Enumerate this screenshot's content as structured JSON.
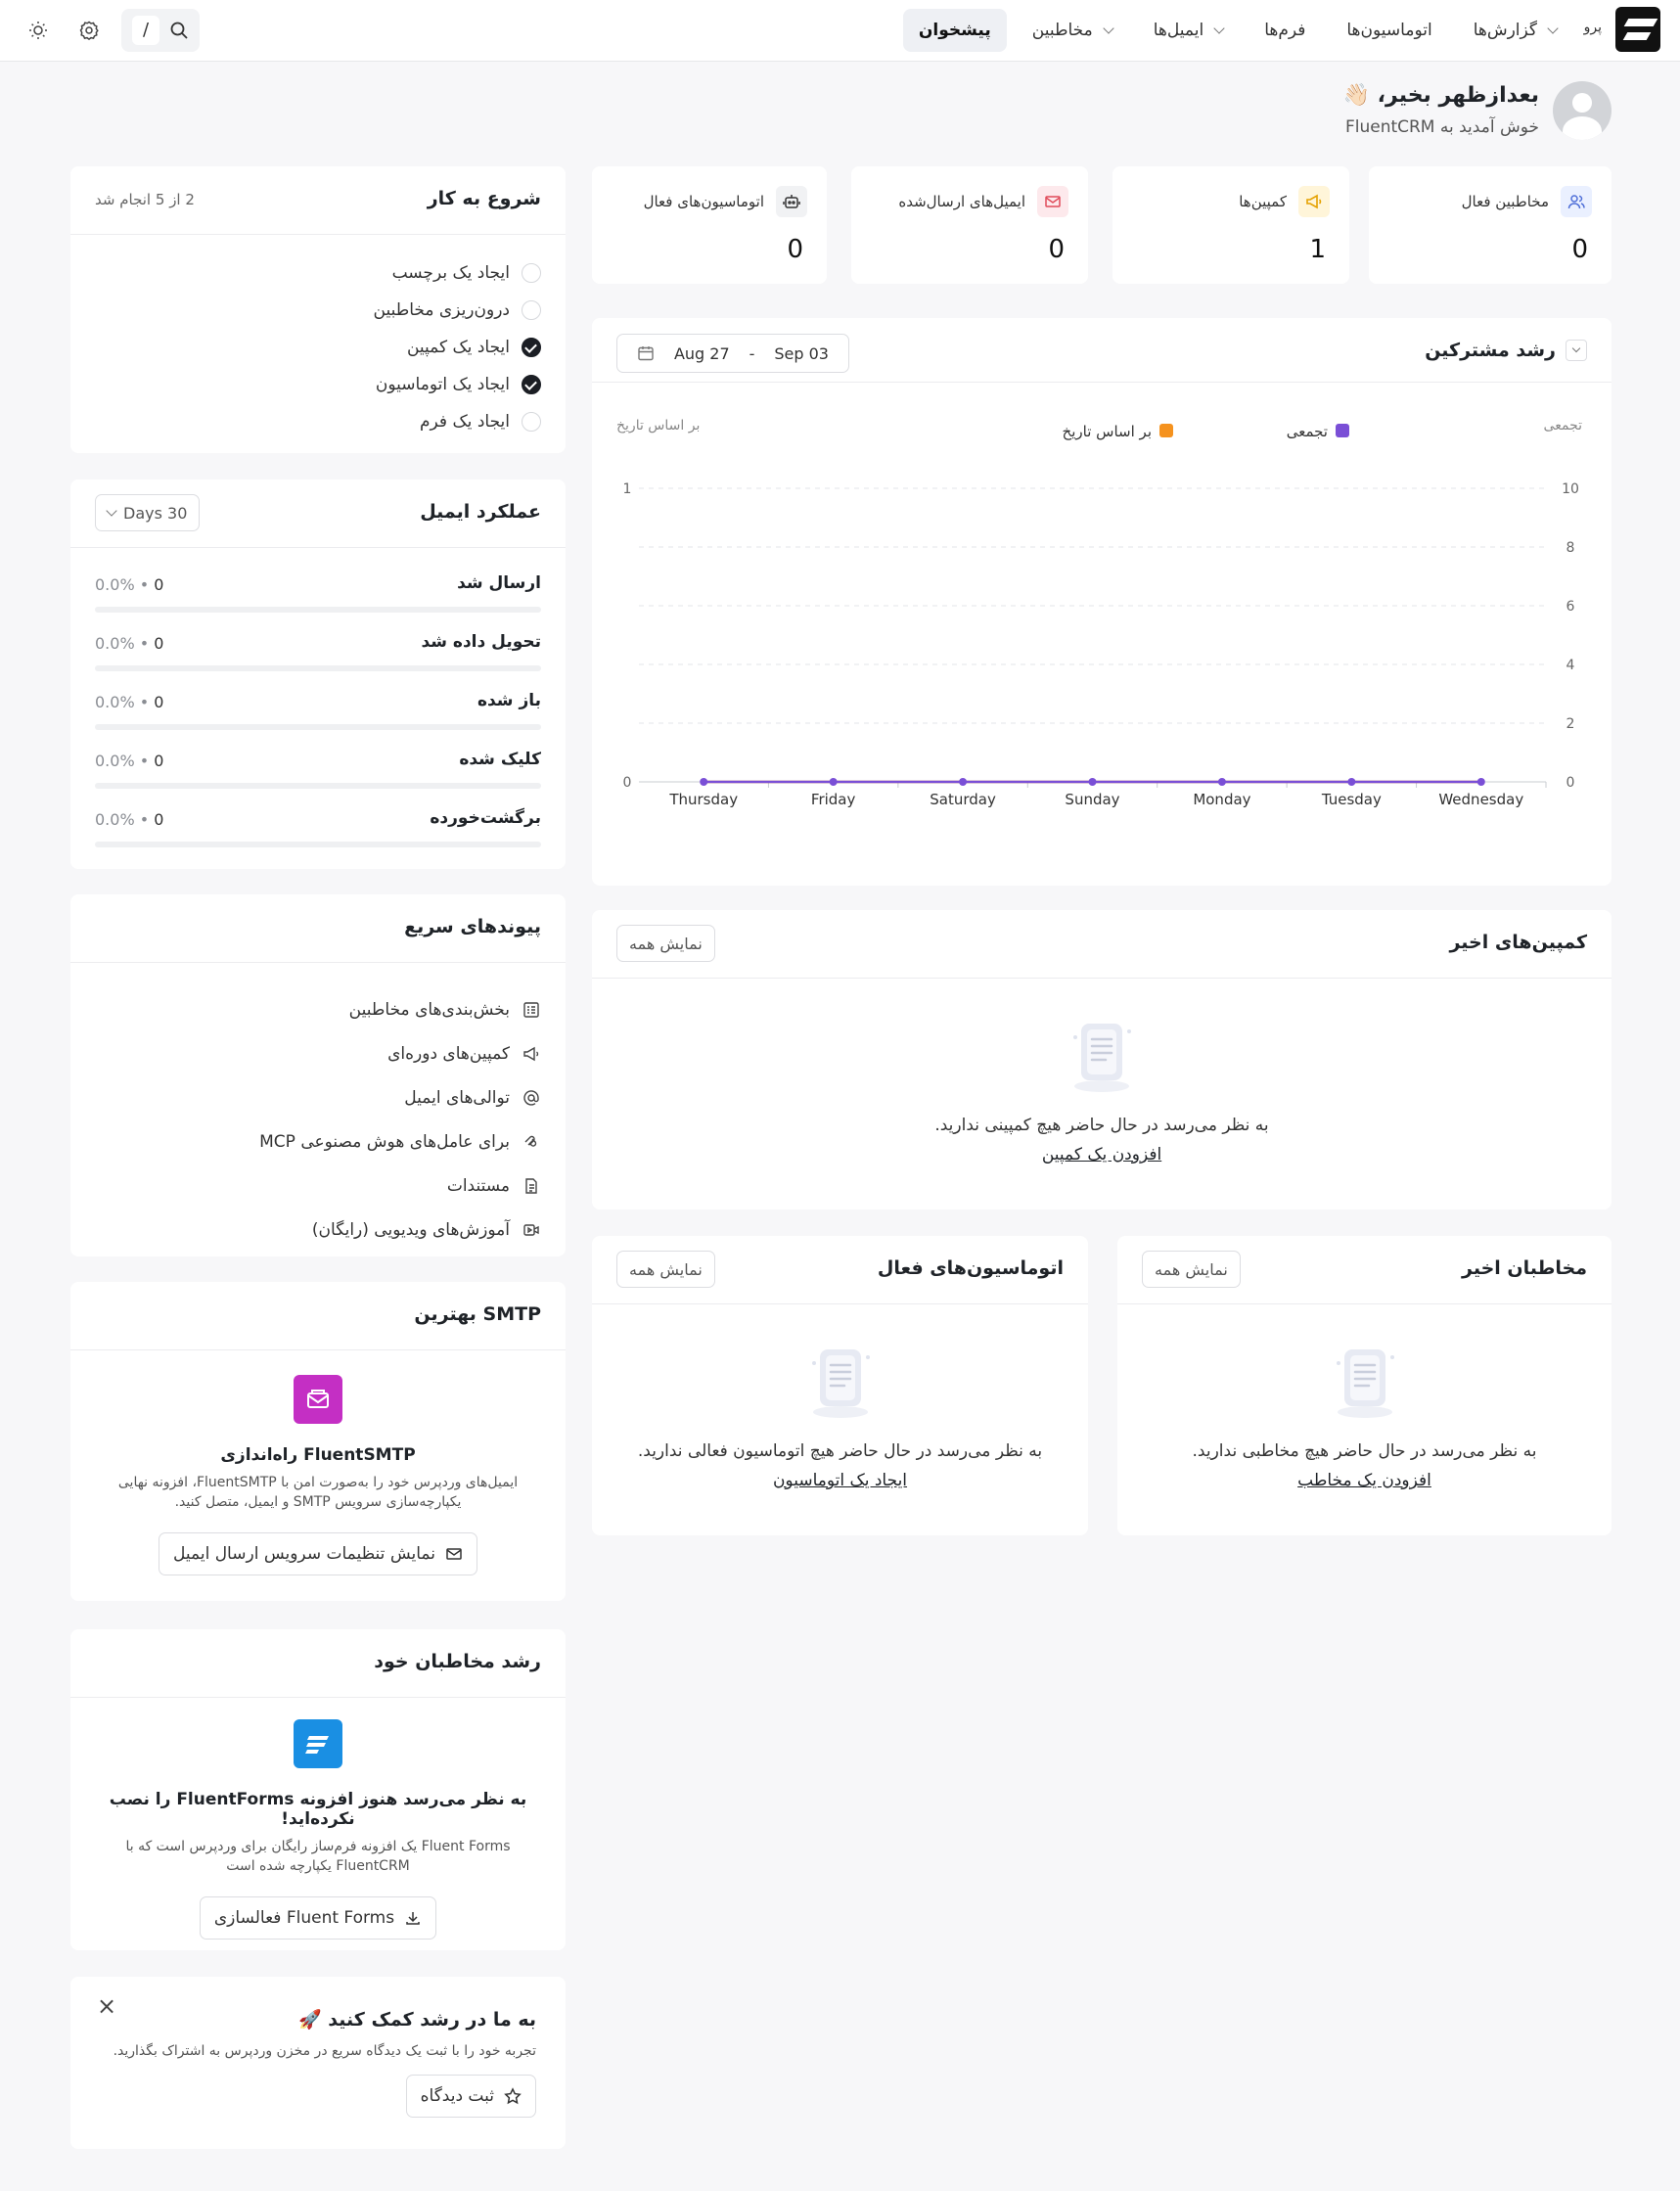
{
  "nav": {
    "brand_tag": "پرو",
    "items": [
      {
        "label": "پیشخوان",
        "active": true,
        "dropdown": false
      },
      {
        "label": "مخاطبین",
        "active": false,
        "dropdown": true
      },
      {
        "label": "ایمیل‌ها",
        "active": false,
        "dropdown": true
      },
      {
        "label": "فرم‌ها",
        "active": false,
        "dropdown": false
      },
      {
        "label": "اتوماسیون‌ها",
        "active": false,
        "dropdown": false
      },
      {
        "label": "گزارش‌ها",
        "active": false,
        "dropdown": true
      }
    ],
    "search_shortcut": "/"
  },
  "greeting": {
    "title": "بعدازظهر بخیر، 👋🏻",
    "subtitle": "خوش آمدید به FluentCRM"
  },
  "stats": [
    {
      "label": "مخاطبین فعال",
      "value": "0",
      "icon": "users-icon",
      "color": "#4f6fd8",
      "bg": "#eaf0ff"
    },
    {
      "label": "کمپین‌ها",
      "value": "1",
      "icon": "megaphone-icon",
      "color": "#e5a100",
      "bg": "#fff5d9"
    },
    {
      "label": "ایمیل‌های ارسال‌شده",
      "value": "0",
      "icon": "mail-icon",
      "color": "#e04b5a",
      "bg": "#fde9ec"
    },
    {
      "label": "اتوماسیون‌های فعال",
      "value": "0",
      "icon": "robot-icon",
      "color": "#333333",
      "bg": "#f1f2f4"
    }
  ],
  "growth": {
    "title": "رشد مشترکین",
    "date_from": "Aug 27",
    "date_sep": "-",
    "date_to": "Sep 03"
  },
  "chart_data": {
    "type": "line",
    "categories": [
      "Thursday",
      "Friday",
      "Saturday",
      "Sunday",
      "Monday",
      "Tuesday",
      "Wednesday"
    ],
    "series": [
      {
        "name": "تجمعی",
        "color": "#7a4fd6",
        "values": [
          0,
          0,
          0,
          0,
          0,
          0,
          0
        ]
      },
      {
        "name": "بر اساس تاریخ",
        "color": "#f5921e",
        "values": [
          0,
          0,
          0,
          0,
          0,
          0,
          0
        ]
      }
    ],
    "right_axis_label": "تجمعی",
    "left_axis_label": "بر اساس تاریخ",
    "right_ylim": [
      0,
      10
    ],
    "right_ticks": [
      "10",
      "8",
      "6",
      "4",
      "2",
      "0"
    ],
    "left_ylim": [
      0,
      1
    ],
    "left_ticks": [
      "1",
      "0"
    ],
    "grid": true,
    "legend_position": "top-center"
  },
  "getting_started": {
    "title": "شروع به کار",
    "progress": "2 از 5 انجام شد",
    "items": [
      {
        "label": "ایجاد یک برچسب",
        "done": false
      },
      {
        "label": "درون‌ریزی مخاطبین",
        "done": false
      },
      {
        "label": "ایجاد یک کمپین",
        "done": true
      },
      {
        "label": "ایجاد یک اتوماسیون",
        "done": true
      },
      {
        "label": "ایجاد یک فرم",
        "done": false
      }
    ]
  },
  "email_performance": {
    "title": "عملکرد ایمیل",
    "range": "Days 30",
    "rows": [
      {
        "label": "ارسال شد",
        "count": "0",
        "percent": "0.0%",
        "fraction": 0
      },
      {
        "label": "تحویل داده شد",
        "count": "0",
        "percent": "0.0%",
        "fraction": 0
      },
      {
        "label": "باز شده",
        "count": "0",
        "percent": "0.0%",
        "fraction": 0
      },
      {
        "label": "کلیک شده",
        "count": "0",
        "percent": "0.0%",
        "fraction": 0
      },
      {
        "label": "برگشت‌خورده",
        "count": "0",
        "percent": "0.0%",
        "fraction": 0
      }
    ]
  },
  "quick_links": {
    "title": "پیوندهای سریع",
    "items": [
      {
        "label": "بخش‌بندی‌های مخاطبین",
        "icon": "segments-icon"
      },
      {
        "label": "کمپین‌های دوره‌ای",
        "icon": "megaphone-icon"
      },
      {
        "label": "توالی‌های ایمیل",
        "icon": "at-icon"
      },
      {
        "label": "MCP برای عامل‌های هوش مصنوعی",
        "icon": "mcp-icon"
      },
      {
        "label": "مستندات",
        "icon": "document-icon"
      },
      {
        "label": "آموزش‌های ویدیویی (رایگان)",
        "icon": "video-icon"
      }
    ]
  },
  "smtp": {
    "title": "بهترین SMTP",
    "promo_title": "راه‌اندازی FluentSMTP",
    "desc": "ایمیل‌های وردپرس خود را به‌صورت امن با FluentSMTP، افزونه نهایی یکپارچه‌سازی سرویس SMTP و ایمیل، متصل کنید.",
    "button": "نمایش تنظیمات سرویس ارسال ایمیل",
    "color": "#c42fc4"
  },
  "grow": {
    "title": "رشد مخاطبان خود",
    "promo_title": "به نظر می‌رسد هنوز افزونه FluentForms را نصب نکرده‌اید!",
    "desc": "Fluent Forms یک افزونه فرم‌ساز رایگان برای وردپرس است که با FluentCRM یکپارچه شده است",
    "button": "فعالسازی Fluent Forms",
    "color": "#1a8fe3"
  },
  "help": {
    "title": "به ما در رشد کمک کنید 🚀",
    "desc": "تجربه خود را با ثبت یک دیدگاه سریع در مخزن وردپرس به اشتراک بگذارید.",
    "button": "ثبت دیدگاه",
    "close": "×"
  },
  "recent_campaigns": {
    "title": "کمپین‌های اخیر",
    "view_all": "نمایش همه",
    "empty_text": "به نظر می‌رسد در حال حاضر هیچ کمپینی ندارید.",
    "empty_link": "افزودن یک کمپین"
  },
  "recent_contacts": {
    "title": "مخاطبان اخیر",
    "view_all": "نمایش همه",
    "empty_text": "به نظر می‌رسد در حال حاضر هیچ مخاطبی ندارید.",
    "empty_link": "افزودن یک مخاطب"
  },
  "active_automations": {
    "title": "اتوماسیون‌های فعال",
    "view_all": "نمایش همه",
    "empty_text": "به نظر می‌رسد در حال حاضر هیچ اتوماسیون فعالی ندارید.",
    "empty_link": "ایجاد یک اتوماسیون"
  }
}
